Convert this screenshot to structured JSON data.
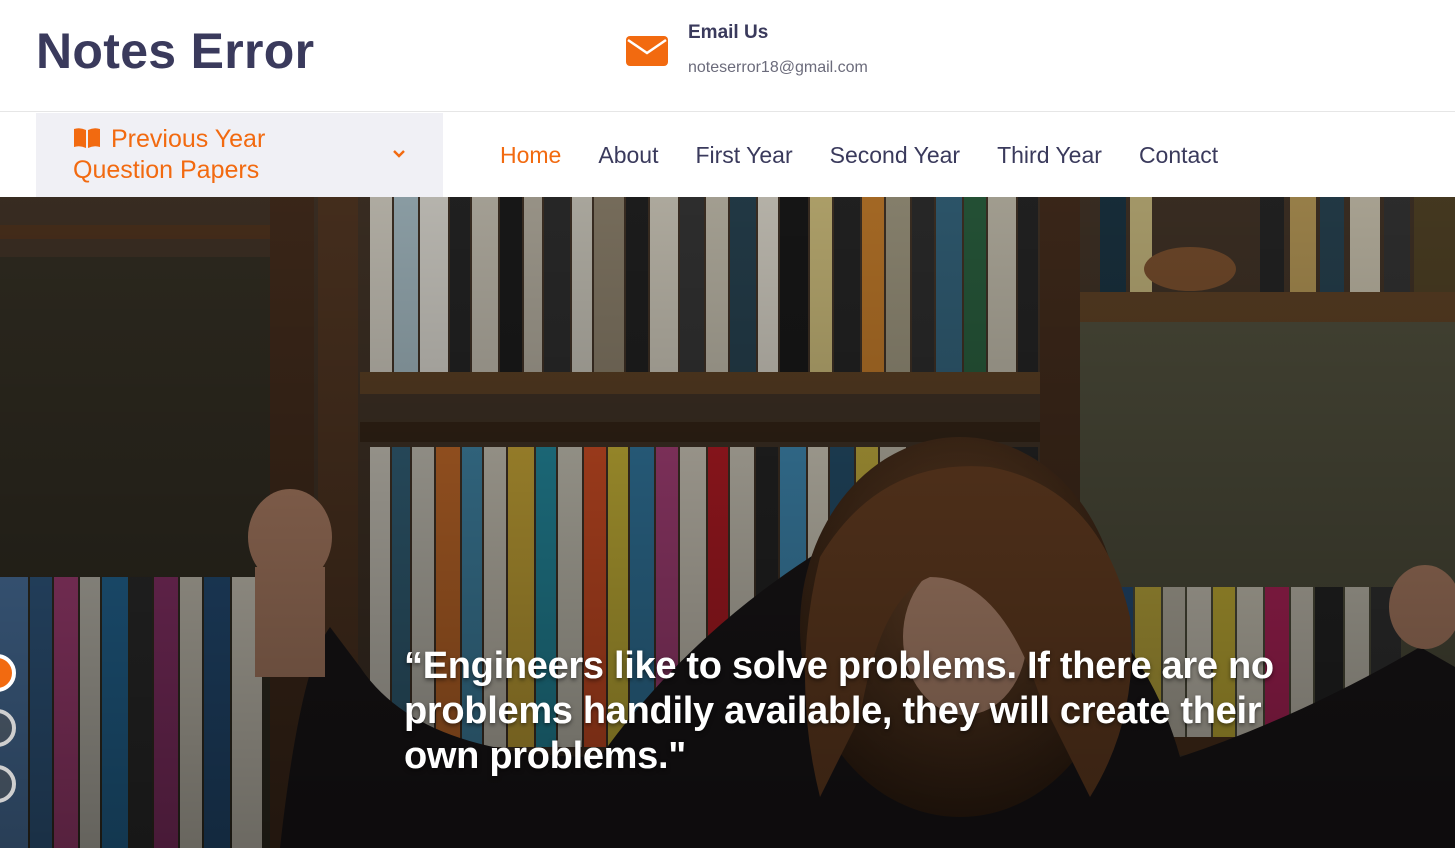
{
  "header": {
    "logo": "Notes Error",
    "contact_title": "Email Us",
    "contact_email": "noteserror18@gmail.com"
  },
  "nav": {
    "dropdown_line1": "Previous Year",
    "dropdown_line2": "Question Papers",
    "items": [
      "Home",
      "About",
      "First Year",
      "Second Year",
      "Third Year",
      "Contact"
    ],
    "active_item": "Home"
  },
  "hero": {
    "quote_line1": "“Engineers like to solve problems. If there are no",
    "quote_line2": "problems handily available, they will create their",
    "quote_line3": "own problems.\"",
    "slides": 3,
    "active_slide": 1
  },
  "colors": {
    "accent": "#f26a10",
    "text_dark": "#3a3a5c",
    "dropdown_bg": "#f0f0f5"
  }
}
